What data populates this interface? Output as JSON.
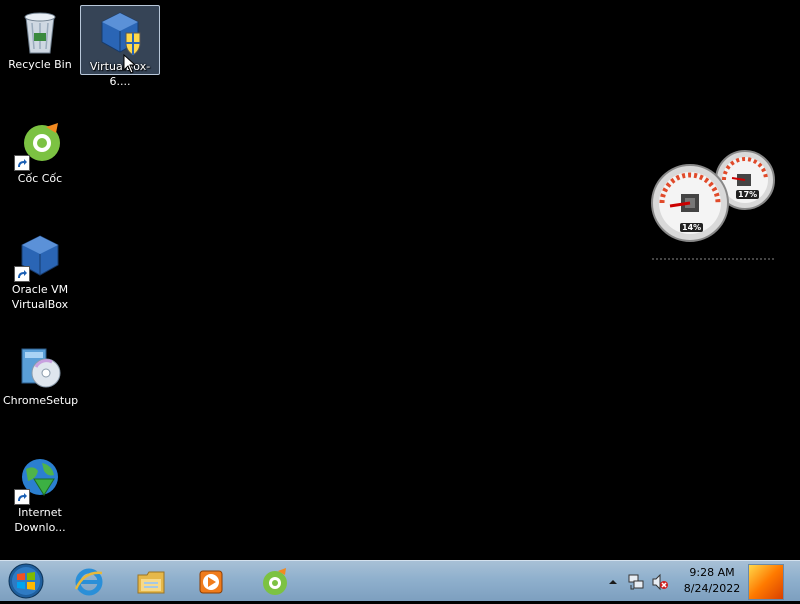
{
  "desktop": {
    "icons": [
      {
        "label": "Recycle Bin"
      },
      {
        "label": "VirtualBox-6...."
      },
      {
        "label": "Cốc Cốc"
      },
      {
        "label": "Oracle VM VirtualBox"
      },
      {
        "label": "ChromeSetup"
      },
      {
        "label": "Internet Downlo..."
      }
    ]
  },
  "gadgets": {
    "cpu_meter": {
      "cpu_percent": "14%",
      "memory_percent": "17%"
    }
  },
  "taskbar": {
    "pinned": [
      {
        "name": "Internet Explorer"
      },
      {
        "name": "Windows Explorer"
      },
      {
        "name": "Windows Media Player"
      },
      {
        "name": "Cốc Cốc"
      }
    ],
    "clock": {
      "time": "9:28 AM",
      "date": "8/24/2022"
    }
  },
  "colors": {
    "taskbar": "#8fb0cd",
    "selection": "#7896be"
  }
}
